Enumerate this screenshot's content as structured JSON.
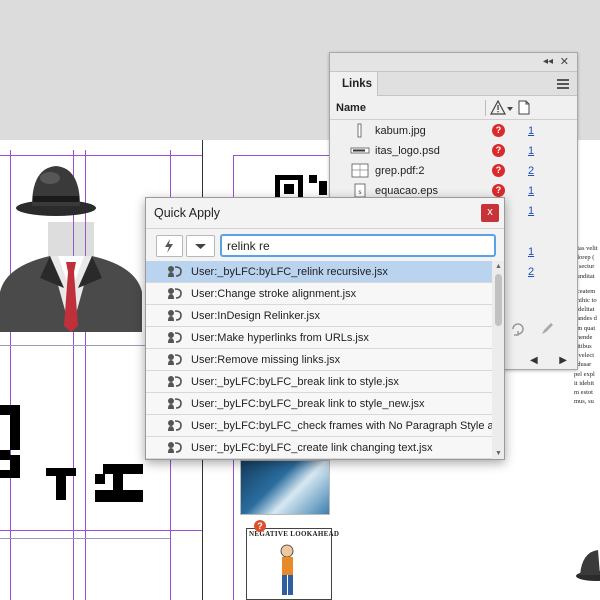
{
  "links_panel": {
    "tab_label": "Links",
    "collapse_glyph": "◂◂",
    "close_glyph": "✕",
    "header_name": "Name",
    "status_glyph": "?",
    "rows": [
      {
        "name": "kabum.jpg",
        "page": "1"
      },
      {
        "name": "itas_logo.psd",
        "page": "1"
      },
      {
        "name": "grep.pdf:2",
        "page": "2"
      },
      {
        "name": "equacao.eps",
        "page": "1"
      },
      {
        "name": "",
        "page": "1"
      },
      {
        "name": "",
        "page": "1"
      },
      {
        "name": "",
        "page": "2"
      }
    ],
    "nav_prev": "◀",
    "nav_next": "▶"
  },
  "quick_apply": {
    "title": "Quick Apply",
    "close_label": "x",
    "search_value": "relink re",
    "items": [
      "User:_byLFC:byLFC_relink recursive.jsx",
      "User:Change stroke alignment.jsx",
      "User:InDesign Relinker.jsx",
      "User:Make hyperlinks from URLs.jsx",
      "User:Remove missing links.jsx",
      "User:_byLFC:byLFC_break link to style.jsx",
      "User:_byLFC:byLFC_break link to style_new.jsx",
      "User:_byLFC:byLFC_check frames with No Paragraph Style appli...",
      "User:_byLFC:byLFC_create link changing text.jsx"
    ],
    "selected_index": 0
  },
  "document": {
    "neg_title": "NEGATIVE LOOKAHEAD",
    "body_text": [
      "otas velit",
      "olorep (",
      "n sectur",
      "sunditat",
      "aceatem",
      "anihic to",
      "s delitat",
      "dandes d",
      "um quat",
      "ehende",
      "pitibus",
      "a velect",
      "ndusar",
      "pel expl",
      "it idebit",
      "m estot",
      "mus, su"
    ]
  },
  "colors": {
    "accent_blue": "#5aa2e8",
    "selection": "#bad3ef",
    "close_red": "#c8333a",
    "missing_red": "#d92b2b",
    "guide_purple": "#9b4fd6"
  }
}
